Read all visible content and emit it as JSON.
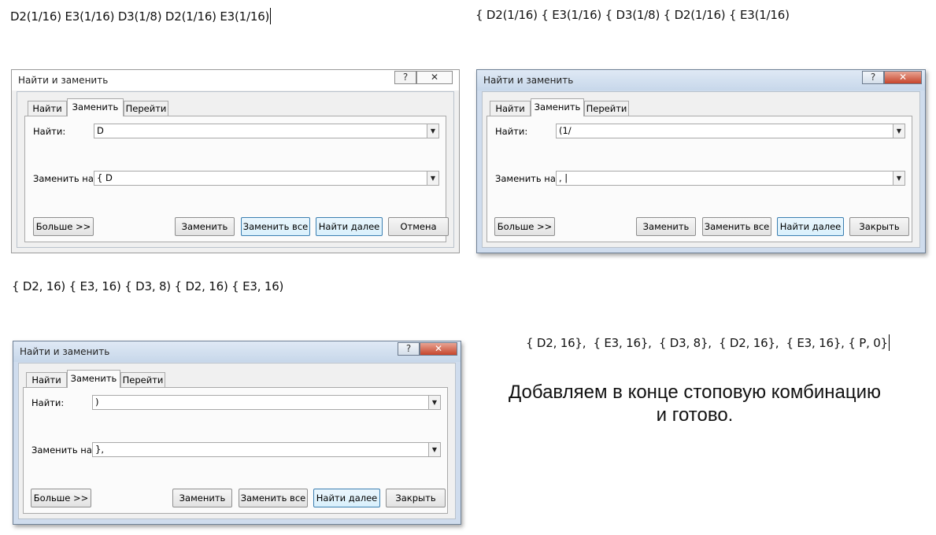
{
  "text_lines": {
    "line1": "D2(1/16) E3(1/16) D3(1/8) D2(1/16) E3(1/16)",
    "line2": "{ D2(1/16) { E3(1/16) { D3(1/8) { D2(1/16) { E3(1/16)",
    "line3": "{ D2, 16) { E3, 16) { D3, 8) { D2, 16) { E3, 16)",
    "line4": "{ D2, 16},  { E3, 16},  { D3, 8},  { D2, 16},  { E3, 16}, { P, 0}"
  },
  "note": {
    "line1": "Добавляем в конце стоповую комбинацию",
    "line2": "и готово."
  },
  "dialogs": [
    {
      "title": "Найти и заменить",
      "help": "?",
      "close": "✕",
      "tabs": [
        "Найти",
        "Заменить",
        "Перейти"
      ],
      "find_label": "Найти:",
      "find_value": "D",
      "replace_label": "Заменить на:",
      "replace_value": "{ D",
      "more_button": "Больше >>",
      "replace_button": "Заменить",
      "replace_all_button": "Заменить все",
      "find_next_button": "Найти далее",
      "close_button": "Отмена"
    },
    {
      "title": "Найти и заменить",
      "help": "?",
      "close": "✕",
      "tabs": [
        "Найти",
        "Заменить",
        "Перейти"
      ],
      "find_label": "Найти:",
      "find_value": "(1/",
      "replace_label": "Заменить на:",
      "replace_value": ", |",
      "more_button": "Больше >>",
      "replace_button": "Заменить",
      "replace_all_button": "Заменить все",
      "find_next_button": "Найти далее",
      "close_button": "Закрыть"
    },
    {
      "title": "Найти и заменить",
      "help": "?",
      "close": "✕",
      "tabs": [
        "Найти",
        "Заменить",
        "Перейти"
      ],
      "find_label": "Найти:",
      "find_value": ")",
      "replace_label": "Заменить на:",
      "replace_value": "},",
      "more_button": "Больше >>",
      "replace_button": "Заменить",
      "replace_all_button": "Заменить все",
      "find_next_button": "Найти далее",
      "close_button": "Закрыть"
    }
  ]
}
